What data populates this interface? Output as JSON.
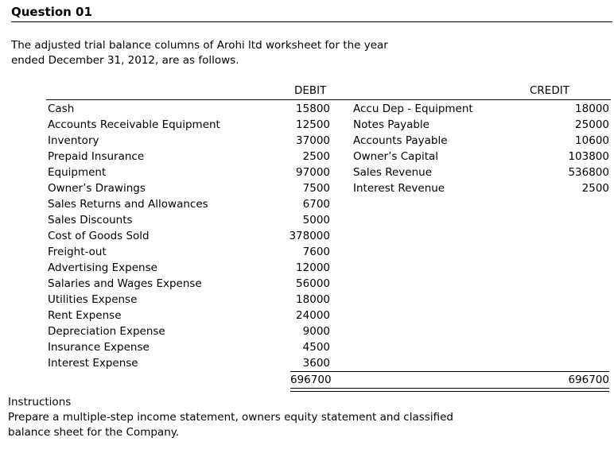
{
  "title": "Question 01",
  "intro": "The adjusted trial balance columns of Arohi ltd worksheet for the year\nended December 31, 2012, are as follows.",
  "table": {
    "headers": {
      "debit": "DEBIT",
      "credit": "CREDIT"
    },
    "rows": [
      {
        "debit_account": "Cash",
        "debit_amount": "15800",
        "credit_account": "Accu Dep - Equipment",
        "credit_amount": "18000"
      },
      {
        "debit_account": "Accounts Receivable Equipment",
        "debit_amount": "12500",
        "credit_account": "Notes Payable",
        "credit_amount": "25000"
      },
      {
        "debit_account": "Inventory",
        "debit_amount": "37000",
        "credit_account": "Accounts Payable",
        "credit_amount": "10600"
      },
      {
        "debit_account": "Prepaid Insurance",
        "debit_amount": "2500",
        "credit_account": "Owner’s Capital",
        "credit_amount": "103800"
      },
      {
        "debit_account": "Equipment",
        "debit_amount": "97000",
        "credit_account": "Sales Revenue",
        "credit_amount": "536800"
      },
      {
        "debit_account": "Owner’s Drawings",
        "debit_amount": "7500",
        "credit_account": "Interest Revenue",
        "credit_amount": "2500"
      },
      {
        "debit_account": "Sales Returns and Allowances",
        "debit_amount": "6700",
        "credit_account": "",
        "credit_amount": ""
      },
      {
        "debit_account": "Sales Discounts",
        "debit_amount": "5000",
        "credit_account": "",
        "credit_amount": ""
      },
      {
        "debit_account": "Cost of Goods Sold",
        "debit_amount": "378000",
        "credit_account": "",
        "credit_amount": ""
      },
      {
        "debit_account": "Freight-out",
        "debit_amount": "7600",
        "credit_account": "",
        "credit_amount": ""
      },
      {
        "debit_account": "Advertising Expense",
        "debit_amount": "12000",
        "credit_account": "",
        "credit_amount": ""
      },
      {
        "debit_account": "Salaries and Wages Expense",
        "debit_amount": "56000",
        "credit_account": "",
        "credit_amount": ""
      },
      {
        "debit_account": "Utilities Expense",
        "debit_amount": "18000",
        "credit_account": "",
        "credit_amount": ""
      },
      {
        "debit_account": "Rent Expense",
        "debit_amount": "24000",
        "credit_account": "",
        "credit_amount": ""
      },
      {
        "debit_account": "Depreciation Expense",
        "debit_amount": "9000",
        "credit_account": "",
        "credit_amount": ""
      },
      {
        "debit_account": "Insurance Expense",
        "debit_amount": "4500",
        "credit_account": "",
        "credit_amount": ""
      },
      {
        "debit_account": "Interest Expense",
        "debit_amount": "3600",
        "credit_account": "",
        "credit_amount": ""
      }
    ],
    "totals": {
      "debit": "696700",
      "credit": "696700"
    }
  },
  "instructions": {
    "heading": "Instructions",
    "body": "Prepare a multiple-step income statement, owners equity statement and classified\nbalance sheet for the Company."
  },
  "colors": {
    "text": "#000000",
    "background": "#ffffff",
    "rule": "#000000"
  }
}
